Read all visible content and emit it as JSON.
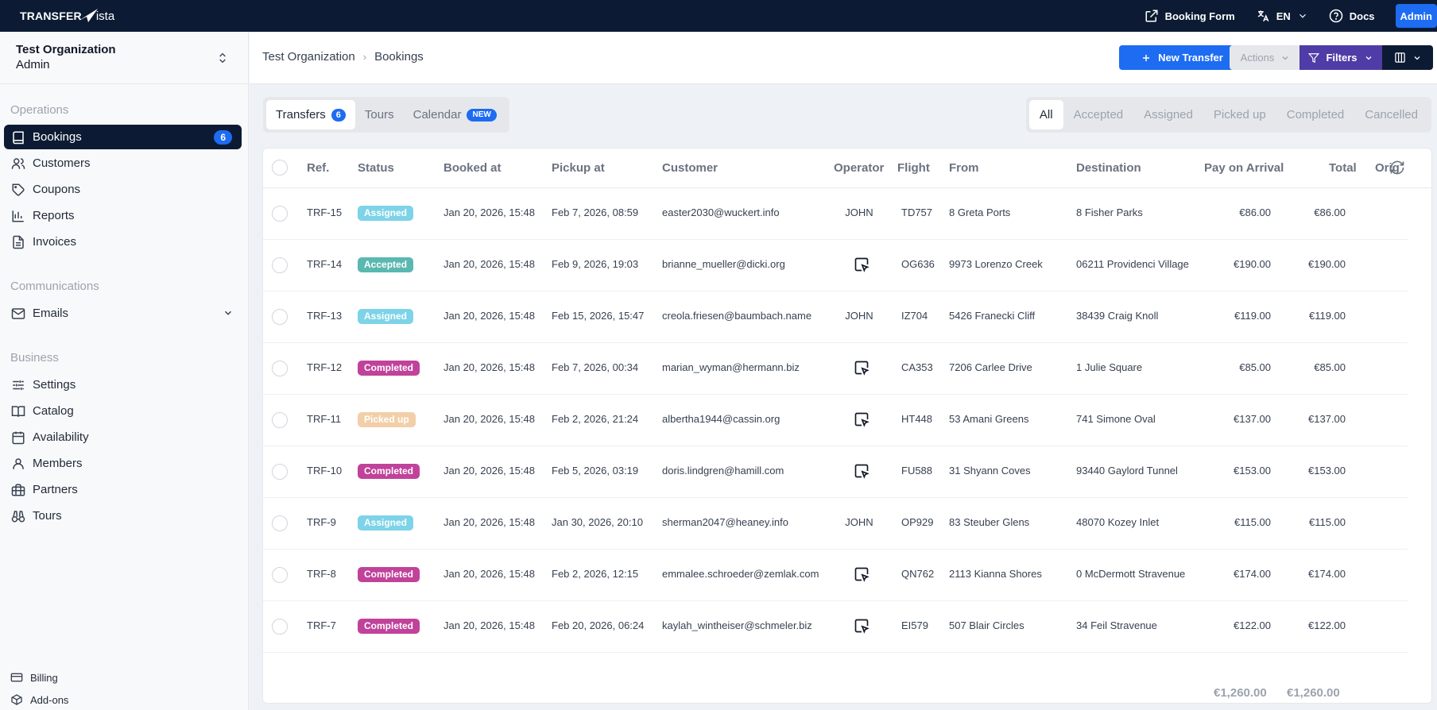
{
  "brand": {
    "part1": "TRANSFER",
    "part2": "ista"
  },
  "topnav": {
    "booking_form": "Booking Form",
    "lang": "EN",
    "docs": "Docs",
    "admin": "Admin"
  },
  "org": {
    "name": "Test Organization",
    "role": "Admin"
  },
  "sidebar": {
    "sections": {
      "operations": "Operations",
      "communications": "Communications",
      "business": "Business"
    },
    "items": {
      "bookings": "Bookings",
      "bookings_count": "6",
      "customers": "Customers",
      "coupons": "Coupons",
      "reports": "Reports",
      "invoices": "Invoices",
      "emails": "Emails",
      "settings": "Settings",
      "catalog": "Catalog",
      "availability": "Availability",
      "members": "Members",
      "partners": "Partners",
      "tours": "Tours"
    },
    "bottom": {
      "billing": "Billing",
      "addons": "Add-ons"
    }
  },
  "breadcrumb": {
    "org": "Test Organization",
    "page": "Bookings"
  },
  "toolbar": {
    "new_transfer": "New Transfer",
    "actions": "Actions",
    "filters": "Filters"
  },
  "tabs": {
    "transfers": "Transfers",
    "transfers_count": "6",
    "tours": "Tours",
    "calendar": "Calendar",
    "calendar_badge": "NEW"
  },
  "status_tabs": [
    "All",
    "Accepted",
    "Assigned",
    "Picked up",
    "Completed",
    "Cancelled"
  ],
  "columns": {
    "ref": "Ref.",
    "status": "Status",
    "booked_at": "Booked at",
    "pickup_at": "Pickup at",
    "customer": "Customer",
    "operator": "Operator",
    "flight": "Flight",
    "from": "From",
    "destination": "Destination",
    "pay_on_arrival": "Pay on Arrival",
    "total": "Total",
    "origin": "Orig"
  },
  "status_colors": {
    "Assigned": "#7dd3e8",
    "Accepted": "#5ab8b0",
    "Completed": "#c0429a",
    "Picked up": "#f2cfa8"
  },
  "rows": [
    {
      "ref": "TRF-15",
      "status": "Assigned",
      "booked": "Jan 20, 2026, 15:48",
      "pickup": "Feb 7, 2026, 08:59",
      "customer": "easter2030@wuckert.info",
      "operator": "JOHN",
      "flight": "TD757",
      "from": "8 Greta Ports",
      "dest": "8 Fisher Parks",
      "poa": "€86.00",
      "total": "€86.00"
    },
    {
      "ref": "TRF-14",
      "status": "Accepted",
      "booked": "Jan 20, 2026, 15:48",
      "pickup": "Feb 9, 2026, 19:03",
      "customer": "brianne_mueller@dicki.org",
      "operator": "",
      "flight": "OG636",
      "from": "9973 Lorenzo Creek",
      "dest": "06211 Providenci Village",
      "poa": "€190.00",
      "total": "€190.00"
    },
    {
      "ref": "TRF-13",
      "status": "Assigned",
      "booked": "Jan 20, 2026, 15:48",
      "pickup": "Feb 15, 2026, 15:47",
      "customer": "creola.friesen@baumbach.name",
      "operator": "JOHN",
      "flight": "IZ704",
      "from": "5426 Franecki Cliff",
      "dest": "38439 Craig Knoll",
      "poa": "€119.00",
      "total": "€119.00"
    },
    {
      "ref": "TRF-12",
      "status": "Completed",
      "booked": "Jan 20, 2026, 15:48",
      "pickup": "Feb 7, 2026, 00:34",
      "customer": "marian_wyman@hermann.biz",
      "operator": "",
      "flight": "CA353",
      "from": "7206 Carlee Drive",
      "dest": "1 Julie Square",
      "poa": "€85.00",
      "total": "€85.00"
    },
    {
      "ref": "TRF-11",
      "status": "Picked up",
      "booked": "Jan 20, 2026, 15:48",
      "pickup": "Feb 2, 2026, 21:24",
      "customer": "albertha1944@cassin.org",
      "operator": "",
      "flight": "HT448",
      "from": "53 Amani Greens",
      "dest": "741 Simone Oval",
      "poa": "€137.00",
      "total": "€137.00"
    },
    {
      "ref": "TRF-10",
      "status": "Completed",
      "booked": "Jan 20, 2026, 15:48",
      "pickup": "Feb 5, 2026, 03:19",
      "customer": "doris.lindgren@hamill.com",
      "operator": "",
      "flight": "FU588",
      "from": "31 Shyann Coves",
      "dest": "93440 Gaylord Tunnel",
      "poa": "€153.00",
      "total": "€153.00"
    },
    {
      "ref": "TRF-9",
      "status": "Assigned",
      "booked": "Jan 20, 2026, 15:48",
      "pickup": "Jan 30, 2026, 20:10",
      "customer": "sherman2047@heaney.info",
      "operator": "JOHN",
      "flight": "OP929",
      "from": "83 Steuber Glens",
      "dest": "48070 Kozey Inlet",
      "poa": "€115.00",
      "total": "€115.00"
    },
    {
      "ref": "TRF-8",
      "status": "Completed",
      "booked": "Jan 20, 2026, 15:48",
      "pickup": "Feb 2, 2026, 12:15",
      "customer": "emmalee.schroeder@zemlak.com",
      "operator": "",
      "flight": "QN762",
      "from": "2113 Kianna Shores",
      "dest": "0 McDermott Stravenue",
      "poa": "€174.00",
      "total": "€174.00"
    },
    {
      "ref": "TRF-7",
      "status": "Completed",
      "booked": "Jan 20, 2026, 15:48",
      "pickup": "Feb 20, 2026, 06:24",
      "customer": "kaylah_wintheiser@schmeler.biz",
      "operator": "",
      "flight": "EI579",
      "from": "507 Blair Circles",
      "dest": "34 Feil Stravenue",
      "poa": "€122.00",
      "total": "€122.00"
    }
  ],
  "totals": {
    "poa": "€1,260.00",
    "total": "€1,260.00"
  }
}
